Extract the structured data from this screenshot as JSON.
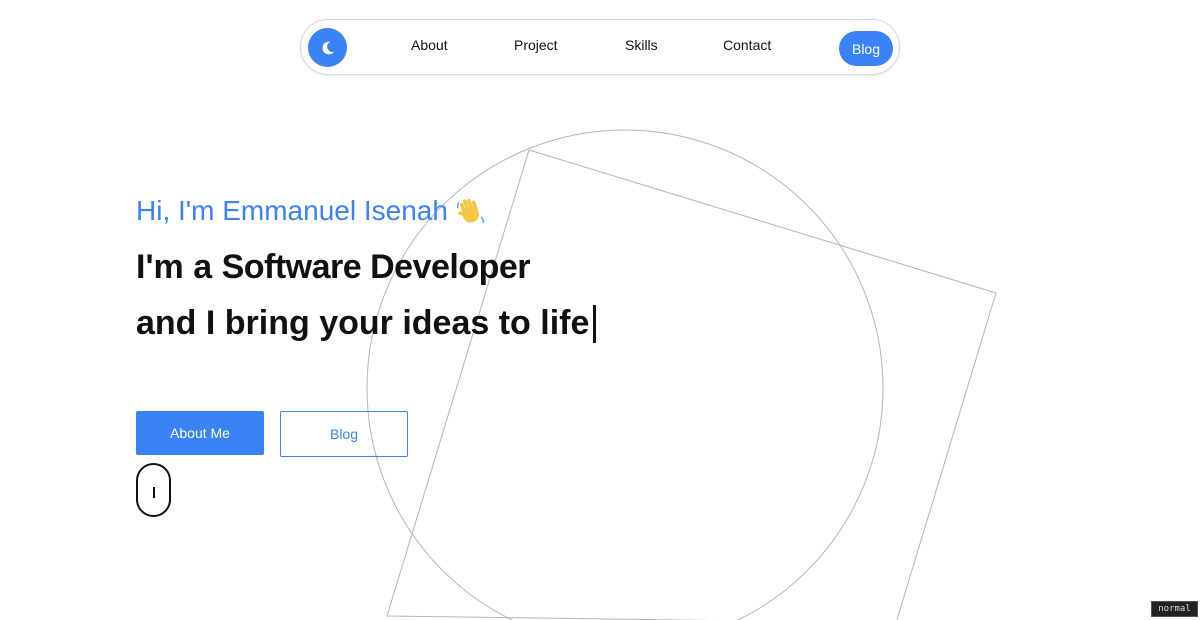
{
  "nav": {
    "theme_toggle_icon": "moon-icon",
    "items": [
      {
        "label": "About"
      },
      {
        "label": "Project"
      },
      {
        "label": "Skills"
      },
      {
        "label": "Contact"
      }
    ],
    "active_item": {
      "label": "Blog"
    }
  },
  "hero": {
    "greeting": "Hi, I'm Emmanuel Isenah",
    "greeting_icon": "waving-hand-icon",
    "line1_prefix": "I'm a",
    "line1_role": "Software Developer",
    "line2": "and I bring your ideas to life"
  },
  "actions": {
    "primary_label": "About Me",
    "secondary_label": "Blog"
  },
  "scroll_icon": "mouse-scroll-icon",
  "mode_badge": "normal",
  "colors": {
    "accent": "#3b82f6",
    "text": "#111111",
    "background": "#ffffff",
    "decoration_stroke": "#b0b0b0"
  }
}
